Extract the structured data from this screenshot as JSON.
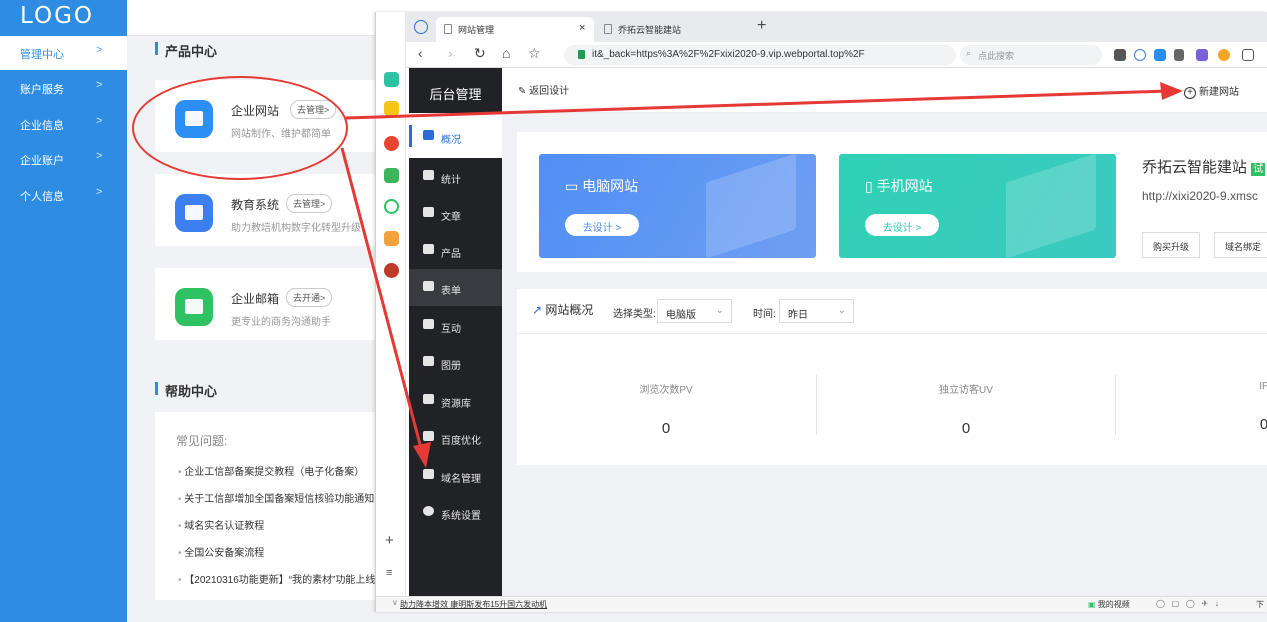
{
  "sidebar": {
    "logo": "LOGO",
    "items": [
      {
        "label": "管理中心"
      },
      {
        "label": "账户服务"
      },
      {
        "label": "企业信息"
      },
      {
        "label": "企业账户"
      },
      {
        "label": "个人信息"
      }
    ]
  },
  "products": {
    "title": "产品中心",
    "cards": [
      {
        "name": "企业网站",
        "action": "去管理>",
        "desc": "网站制作、维护都简单",
        "color": "#2b8ff5"
      },
      {
        "name": "教育系统",
        "action": "去管理>",
        "desc": "助力教培机构数字化转型升级",
        "color": "#3d7ef0"
      },
      {
        "name": "企业邮箱",
        "action": "去开通>",
        "desc": "更专业的商务沟通助手",
        "color": "#2ec262"
      }
    ]
  },
  "help": {
    "title": "帮助中心",
    "faq_title": "常见问题:",
    "items": [
      "企业工信部备案提交教程（电子化备案）",
      "关于工信部增加全国备案短信核验功能通知",
      "域名实名认证教程",
      "全国公安备案流程",
      "【20210316功能更新】“我的素材”功能上线"
    ]
  },
  "browser": {
    "tabs": [
      {
        "label": "网站管理",
        "close": "×"
      },
      {
        "label": "乔拓云智能建站"
      }
    ],
    "new_tab": "+",
    "url": "it&_back=https%3A%2F%2Fxixi2020-9.vip.webportal.top%2F",
    "search_placeholder": "点此搜索",
    "status_news": "助力降本增效 康明斯发布15升国六发动机",
    "status_video": "我的视频",
    "status_download": "下"
  },
  "admin": {
    "title": "后台管理",
    "back_label": "返回设计",
    "new_site_label": "新建网站",
    "nav": [
      {
        "label": "概况",
        "icon": "home-icon"
      },
      {
        "label": "统计",
        "icon": "chart-icon"
      },
      {
        "label": "文章",
        "icon": "article-icon"
      },
      {
        "label": "产品",
        "icon": "grid-icon"
      },
      {
        "label": "表单",
        "icon": "form-icon"
      },
      {
        "label": "互动",
        "icon": "chat-icon"
      },
      {
        "label": "图册",
        "icon": "album-icon"
      },
      {
        "label": "资源库",
        "icon": "database-icon"
      },
      {
        "label": "百度优化",
        "icon": "seo-icon"
      },
      {
        "label": "域名管理",
        "icon": "domain-icon"
      },
      {
        "label": "系统设置",
        "icon": "gear-icon"
      }
    ],
    "pc_site": {
      "title": "电脑网站",
      "button": "去设计 >"
    },
    "mobile_site": {
      "title": "手机网站",
      "button": "去设计 >"
    },
    "brand": "乔拓云智能建站",
    "brand_tag": "试",
    "brand_url": "http://xixi2020-9.xmsc",
    "buy_label": "购买升级",
    "domain_label": "域名绑定",
    "overview": {
      "title": "网站概况",
      "type_label": "选择类型:",
      "type_value": "电脑版",
      "time_label": "时间:",
      "time_value": "昨日",
      "stats": [
        {
          "label": "浏览次数PV",
          "value": "0"
        },
        {
          "label": "独立访客UV",
          "value": "0"
        },
        {
          "label": "IP",
          "value": "0"
        }
      ]
    }
  },
  "colors": {
    "sidebar_blue": "#2e8de3",
    "admin_dark": "#212226",
    "annotation_red": "#e53935",
    "pc_gradient_start": "#4f8ff5",
    "mobile_gradient_start": "#2fd1b5"
  }
}
